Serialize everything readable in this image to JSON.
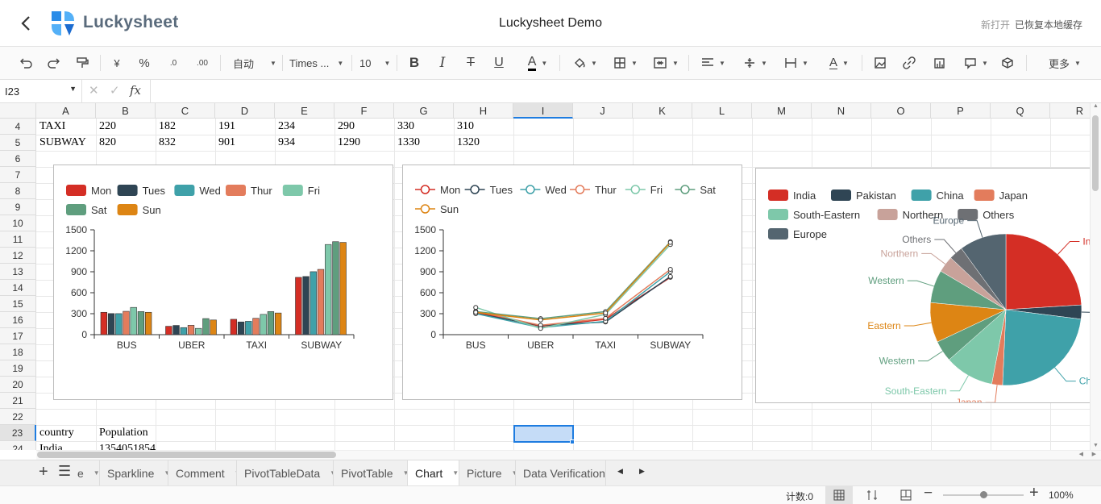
{
  "header": {
    "brand": "Luckysheet",
    "title": "Luckysheet Demo",
    "new_open": "新打开",
    "restored": "已恢复本地缓存"
  },
  "toolbar": {
    "format_auto": "自动",
    "font": "Times ...",
    "size": "10",
    "more": "更多",
    "currency": "¥",
    "percent": "%",
    "dec1": ".0",
    "dec2": ".00"
  },
  "formula": {
    "cell_ref": "I23",
    "fx": "fx"
  },
  "columns": [
    "A",
    "B",
    "C",
    "D",
    "E",
    "F",
    "G",
    "H",
    "I",
    "J",
    "K",
    "L",
    "M",
    "N",
    "O",
    "P",
    "Q",
    "R"
  ],
  "rows": [
    "4",
    "5",
    "6",
    "7",
    "8",
    "9",
    "10",
    "11",
    "12",
    "13",
    "14",
    "15",
    "16",
    "17",
    "18",
    "19",
    "20",
    "21",
    "22",
    "23",
    "24"
  ],
  "cells": [
    {
      "r": 0,
      "c": 0,
      "v": "TAXI"
    },
    {
      "r": 0,
      "c": 1,
      "v": "220"
    },
    {
      "r": 0,
      "c": 2,
      "v": "182"
    },
    {
      "r": 0,
      "c": 3,
      "v": "191"
    },
    {
      "r": 0,
      "c": 4,
      "v": "234"
    },
    {
      "r": 0,
      "c": 5,
      "v": "290"
    },
    {
      "r": 0,
      "c": 6,
      "v": "330"
    },
    {
      "r": 0,
      "c": 7,
      "v": "310"
    },
    {
      "r": 1,
      "c": 0,
      "v": "SUBWAY"
    },
    {
      "r": 1,
      "c": 1,
      "v": "820"
    },
    {
      "r": 1,
      "c": 2,
      "v": "832"
    },
    {
      "r": 1,
      "c": 3,
      "v": "901"
    },
    {
      "r": 1,
      "c": 4,
      "v": "934"
    },
    {
      "r": 1,
      "c": 5,
      "v": "1290"
    },
    {
      "r": 1,
      "c": 6,
      "v": "1330"
    },
    {
      "r": 1,
      "c": 7,
      "v": "1320"
    },
    {
      "r": 19,
      "c": 0,
      "v": "country"
    },
    {
      "r": 19,
      "c": 1,
      "v": "Population"
    },
    {
      "r": 20,
      "c": 0,
      "v": "India"
    },
    {
      "r": 20,
      "c": 1,
      "v": "1354051854"
    }
  ],
  "tabs": [
    "e",
    "Sparkline",
    "Comment",
    "PivotTableData",
    "PivotTable",
    "Chart",
    "Picture",
    "Data Verification"
  ],
  "active_tab": "Chart",
  "status": {
    "count": "计数:0",
    "zoom": "100%"
  },
  "chart_data": [
    {
      "type": "bar",
      "categories": [
        "BUS",
        "UBER",
        "TAXI",
        "SUBWAY"
      ],
      "series": [
        {
          "name": "Mon",
          "values": [
            320,
            120,
            220,
            820
          ],
          "color": "#d42e25"
        },
        {
          "name": "Tues",
          "values": [
            302,
            132,
            182,
            832
          ],
          "color": "#2f4554"
        },
        {
          "name": "Wed",
          "values": [
            301,
            101,
            191,
            901
          ],
          "color": "#3fa1a9"
        },
        {
          "name": "Thur",
          "values": [
            334,
            134,
            234,
            934
          ],
          "color": "#e37c5c"
        },
        {
          "name": "Fri",
          "values": [
            390,
            90,
            290,
            1290
          ],
          "color": "#7ec8aa"
        },
        {
          "name": "Sat",
          "values": [
            330,
            230,
            330,
            1330
          ],
          "color": "#5f9e7e"
        },
        {
          "name": "Sun",
          "values": [
            320,
            210,
            310,
            1320
          ],
          "color": "#dd8514"
        }
      ],
      "yticks": [
        "0",
        "300",
        "600",
        "900",
        "1200",
        "1500"
      ],
      "ylim": [
        0,
        1500
      ]
    },
    {
      "type": "line",
      "categories": [
        "BUS",
        "UBER",
        "TAXI",
        "SUBWAY"
      ],
      "series": [
        {
          "name": "Mon",
          "values": [
            320,
            120,
            220,
            820
          ],
          "color": "#d42e25"
        },
        {
          "name": "Tues",
          "values": [
            302,
            132,
            182,
            832
          ],
          "color": "#2f4554"
        },
        {
          "name": "Wed",
          "values": [
            301,
            101,
            191,
            901
          ],
          "color": "#3fa1a9"
        },
        {
          "name": "Thur",
          "values": [
            334,
            134,
            234,
            934
          ],
          "color": "#e37c5c"
        },
        {
          "name": "Fri",
          "values": [
            390,
            90,
            290,
            1290
          ],
          "color": "#7ec8aa"
        },
        {
          "name": "Sat",
          "values": [
            330,
            230,
            330,
            1330
          ],
          "color": "#5f9e7e"
        },
        {
          "name": "Sun",
          "values": [
            320,
            210,
            310,
            1320
          ],
          "color": "#dd8514"
        }
      ],
      "yticks": [
        "0",
        "300",
        "600",
        "900",
        "1200",
        "1500"
      ],
      "ylim": [
        0,
        1500
      ]
    },
    {
      "type": "pie",
      "legend": [
        {
          "name": "India",
          "color": "#d42e25"
        },
        {
          "name": "Pakistan",
          "color": "#2f4554"
        },
        {
          "name": "China",
          "color": "#3fa1a9"
        },
        {
          "name": "Japan",
          "color": "#e37c5c"
        },
        {
          "name": "South-Eastern",
          "color": "#7ec8aa"
        },
        {
          "name": "Northern",
          "color": "#c8a29a"
        },
        {
          "name": "Others",
          "color": "#6e7074"
        },
        {
          "name": "Europe",
          "color": "#546570"
        }
      ],
      "slices": [
        {
          "name": "India",
          "value": 24.0,
          "color": "#d42e25"
        },
        {
          "name": "Pakistan",
          "value": 3.0,
          "color": "#2f4554"
        },
        {
          "name": "China",
          "value": 23.7,
          "color": "#3fa1a9"
        },
        {
          "name": "Japan",
          "value": 2.3,
          "color": "#e37c5c"
        },
        {
          "name": "South-Eastern",
          "value": 10.5,
          "color": "#7ec8aa"
        },
        {
          "name": "Western",
          "value": 4.5,
          "color": "#5f9e7e"
        },
        {
          "name": "Eastern",
          "value": 8.5,
          "color": "#dd8514"
        },
        {
          "name": "Western",
          "value": 7.0,
          "color": "#5f9e7e"
        },
        {
          "name": "Northern",
          "value": 3.5,
          "color": "#c8a29a"
        },
        {
          "name": "Others",
          "value": 3.0,
          "color": "#6e7074"
        },
        {
          "name": "Europe",
          "value": 10.0,
          "color": "#546570"
        }
      ]
    }
  ]
}
